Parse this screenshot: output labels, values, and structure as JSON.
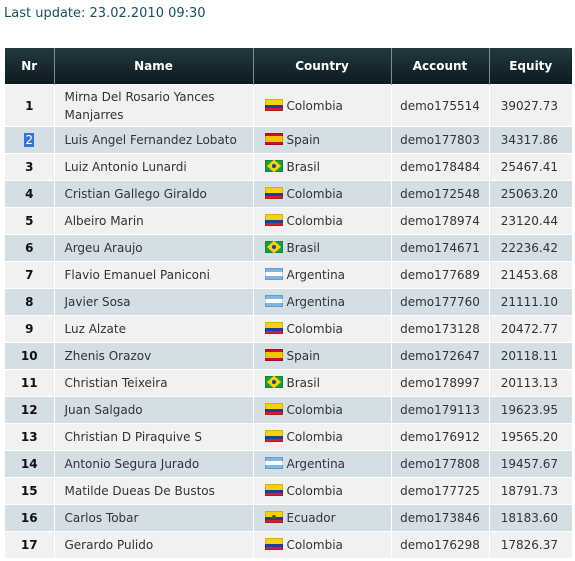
{
  "last_update": "Last update: 23.02.2010 09:30",
  "table": {
    "headers": {
      "nr": "Nr",
      "name": "Name",
      "country": "Country",
      "account": "Account",
      "equity": "Equity"
    },
    "rows": [
      {
        "nr": "1",
        "name": "Mirna Del Rosario Yances Manjarres",
        "country": "Colombia",
        "flag": "colombia-flag-icon",
        "account": "demo175514",
        "equity": "39027.73"
      },
      {
        "nr": "2",
        "name": "Luis Angel Fernandez Lobato",
        "country": "Spain",
        "flag": "spain-flag-icon",
        "account": "demo177803",
        "equity": "34317.86"
      },
      {
        "nr": "3",
        "name": "Luiz Antonio Lunardi",
        "country": "Brasil",
        "flag": "brasil-flag-icon",
        "account": "demo178484",
        "equity": "25467.41"
      },
      {
        "nr": "4",
        "name": "Cristian Gallego Giraldo",
        "country": "Colombia",
        "flag": "colombia-flag-icon",
        "account": "demo172548",
        "equity": "25063.20"
      },
      {
        "nr": "5",
        "name": "Albeiro Marin",
        "country": "Colombia",
        "flag": "colombia-flag-icon",
        "account": "demo178974",
        "equity": "23120.44"
      },
      {
        "nr": "6",
        "name": "Argeu Araujo",
        "country": "Brasil",
        "flag": "brasil-flag-icon",
        "account": "demo174671",
        "equity": "22236.42"
      },
      {
        "nr": "7",
        "name": "Flavio Emanuel Paniconi",
        "country": "Argentina",
        "flag": "argentina-flag-icon",
        "account": "demo177689",
        "equity": "21453.68"
      },
      {
        "nr": "8",
        "name": "Javier Sosa",
        "country": "Argentina",
        "flag": "argentina-flag-icon",
        "account": "demo177760",
        "equity": "21111.10"
      },
      {
        "nr": "9",
        "name": "Luz Alzate",
        "country": "Colombia",
        "flag": "colombia-flag-icon",
        "account": "demo173128",
        "equity": "20472.77"
      },
      {
        "nr": "10",
        "name": "Zhenis Orazov",
        "country": "Spain",
        "flag": "spain-flag-icon",
        "account": "demo172647",
        "equity": "20118.11"
      },
      {
        "nr": "11",
        "name": "Christian Teixeira",
        "country": "Brasil",
        "flag": "brasil-flag-icon",
        "account": "demo178997",
        "equity": "20113.13"
      },
      {
        "nr": "12",
        "name": "Juan Salgado",
        "country": "Colombia",
        "flag": "colombia-flag-icon",
        "account": "demo179113",
        "equity": "19623.95"
      },
      {
        "nr": "13",
        "name": "Christian D Piraquive S",
        "country": "Colombia",
        "flag": "colombia-flag-icon",
        "account": "demo176912",
        "equity": "19565.20"
      },
      {
        "nr": "14",
        "name": "Antonio Segura Jurado",
        "country": "Argentina",
        "flag": "argentina-flag-icon",
        "account": "demo177808",
        "equity": "19457.67"
      },
      {
        "nr": "15",
        "name": "Matilde Dueas De Bustos",
        "country": "Colombia",
        "flag": "colombia-flag-icon",
        "account": "demo177725",
        "equity": "18791.73"
      },
      {
        "nr": "16",
        "name": "Carlos Tobar",
        "country": "Ecuador",
        "flag": "ecuador-flag-icon",
        "account": "demo173846",
        "equity": "18183.60"
      },
      {
        "nr": "17",
        "name": "Gerardo Pulido",
        "country": "Colombia",
        "flag": "colombia-flag-icon",
        "account": "demo176298",
        "equity": "17826.37"
      }
    ]
  }
}
